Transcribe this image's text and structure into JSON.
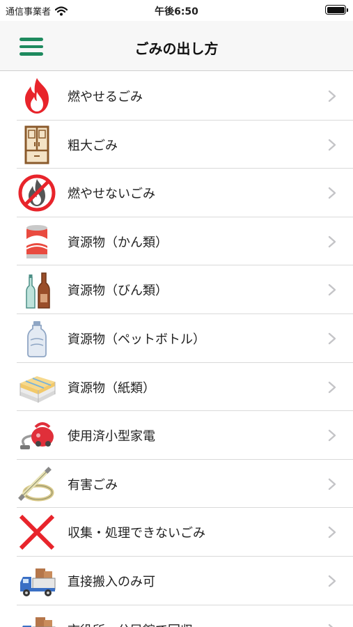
{
  "status_bar": {
    "carrier": "通信事業者",
    "time": "午後6:50"
  },
  "nav": {
    "title": "ごみの出し方"
  },
  "colors": {
    "accent": "#1e8a5e",
    "fire_red": "#e8242b",
    "prohibit_red": "#e8242b"
  },
  "items": [
    {
      "label": "燃やせるごみ",
      "icon": "flame-icon"
    },
    {
      "label": "粗大ごみ",
      "icon": "cabinet-icon"
    },
    {
      "label": "燃やせないごみ",
      "icon": "no-burn-icon"
    },
    {
      "label": "資源物（かん類）",
      "icon": "can-icon"
    },
    {
      "label": "資源物（びん類）",
      "icon": "bottles-icon"
    },
    {
      "label": "資源物（ペットボトル）",
      "icon": "pet-bottle-icon"
    },
    {
      "label": "資源物（紙類）",
      "icon": "paper-bundle-icon"
    },
    {
      "label": "使用済小型家電",
      "icon": "vacuum-cleaner-icon"
    },
    {
      "label": "有害ごみ",
      "icon": "fluorescent-lamp-icon"
    },
    {
      "label": "収集・処理できないごみ",
      "icon": "red-x-icon"
    },
    {
      "label": "直接搬入のみ可",
      "icon": "truck-icon"
    },
    {
      "label": "市役所・公民館で回収",
      "icon": "truck-boxes-icon"
    }
  ]
}
